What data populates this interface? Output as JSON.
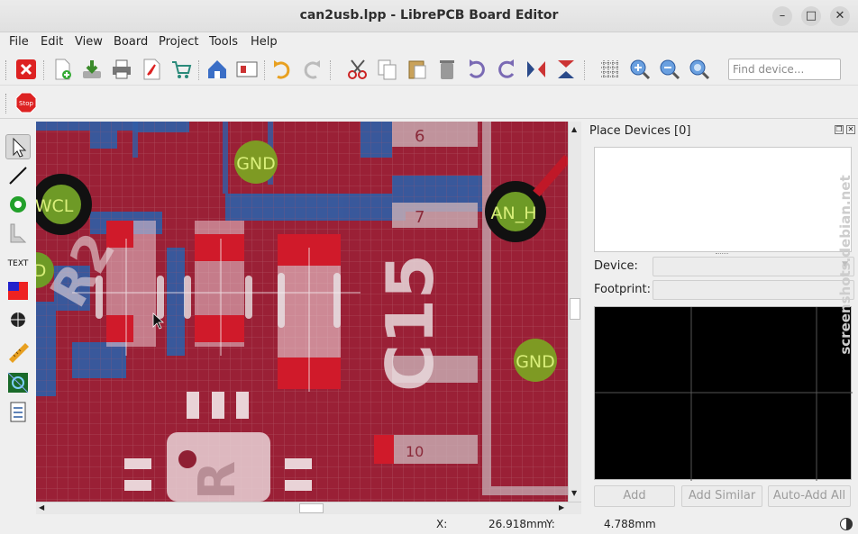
{
  "window": {
    "title": "can2usb.lpp - LibrePCB Board Editor",
    "minimize": "–",
    "maximize": "□",
    "close": "✕"
  },
  "menu": [
    "File",
    "Edit",
    "View",
    "Board",
    "Project",
    "Tools",
    "Help"
  ],
  "toolbar": {
    "find_placeholder": "Find device...",
    "icons": [
      "close-project-icon",
      "new-icon",
      "save-icon",
      "print-icon",
      "export-pdf-icon",
      "order-pcb-icon",
      "control-panel-icon",
      "schematic-icon",
      "undo-icon",
      "redo-icon",
      "cut-icon",
      "copy-icon",
      "paste-icon",
      "delete-icon",
      "rotate-ccw-icon",
      "rotate-cw-icon",
      "flip-horizontal-icon",
      "flip-vertical-icon",
      "grid-icon",
      "zoom-in-icon",
      "zoom-out-icon",
      "zoom-fit-icon"
    ]
  },
  "toolbar2": {
    "stop_label": "Stop"
  },
  "left_tools": {
    "text_label": "TEXT"
  },
  "canvas": {
    "labels": {
      "gnd_top": "GND",
      "gnd_right": "GND",
      "can_l": "CAN_L",
      "can_h": "AN_H",
      "c15": "C15",
      "num6": "6",
      "num10": "10",
      "r_left": "R2",
      "r_bottom": "R",
      "d_left": "D",
      "num7": "7",
      "wcl": "WCL"
    }
  },
  "dock": {
    "title": "Place Devices [0]",
    "device_label": "Device:",
    "footprint_label": "Footprint:",
    "add": "Add",
    "add_similar": "Add Similar",
    "auto_add_all": "Auto-Add All"
  },
  "status": {
    "x_label": "X:",
    "x_value": "26.918mm",
    "y_label": "Y:",
    "y_value": "4.788mm"
  },
  "watermark": "screenshots.debian.net"
}
